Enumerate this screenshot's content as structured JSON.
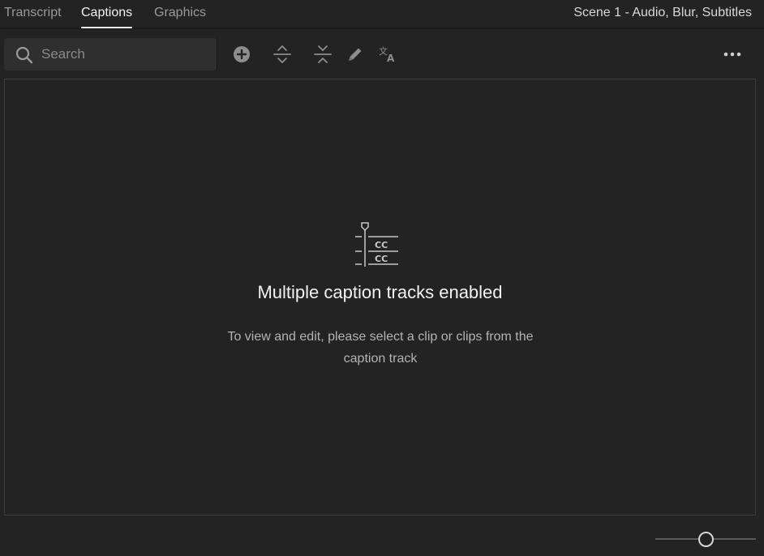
{
  "tabs": [
    {
      "label": "Transcript",
      "active": false
    },
    {
      "label": "Captions",
      "active": true
    },
    {
      "label": "Graphics",
      "active": false
    }
  ],
  "scene_title": "Scene 1 - Audio, Blur, Subtitles",
  "search": {
    "placeholder": "Search",
    "value": ""
  },
  "toolbar": {
    "icons": [
      "add-icon",
      "expand-icon",
      "collapse-icon",
      "pencil-icon",
      "translate-icon",
      "more-icon"
    ]
  },
  "empty_state": {
    "icon": "caption-tracks-icon",
    "title": "Multiple caption tracks enabled",
    "message": "To view and edit, please select a clip or clips from the caption track"
  },
  "zoom": {
    "value_fraction": 0.5
  },
  "colors": {
    "background": "#232323",
    "active_tab_text": "#f2f2f2",
    "inactive_tab_text": "#9a9a9a",
    "icon": "#8e8e8e"
  }
}
